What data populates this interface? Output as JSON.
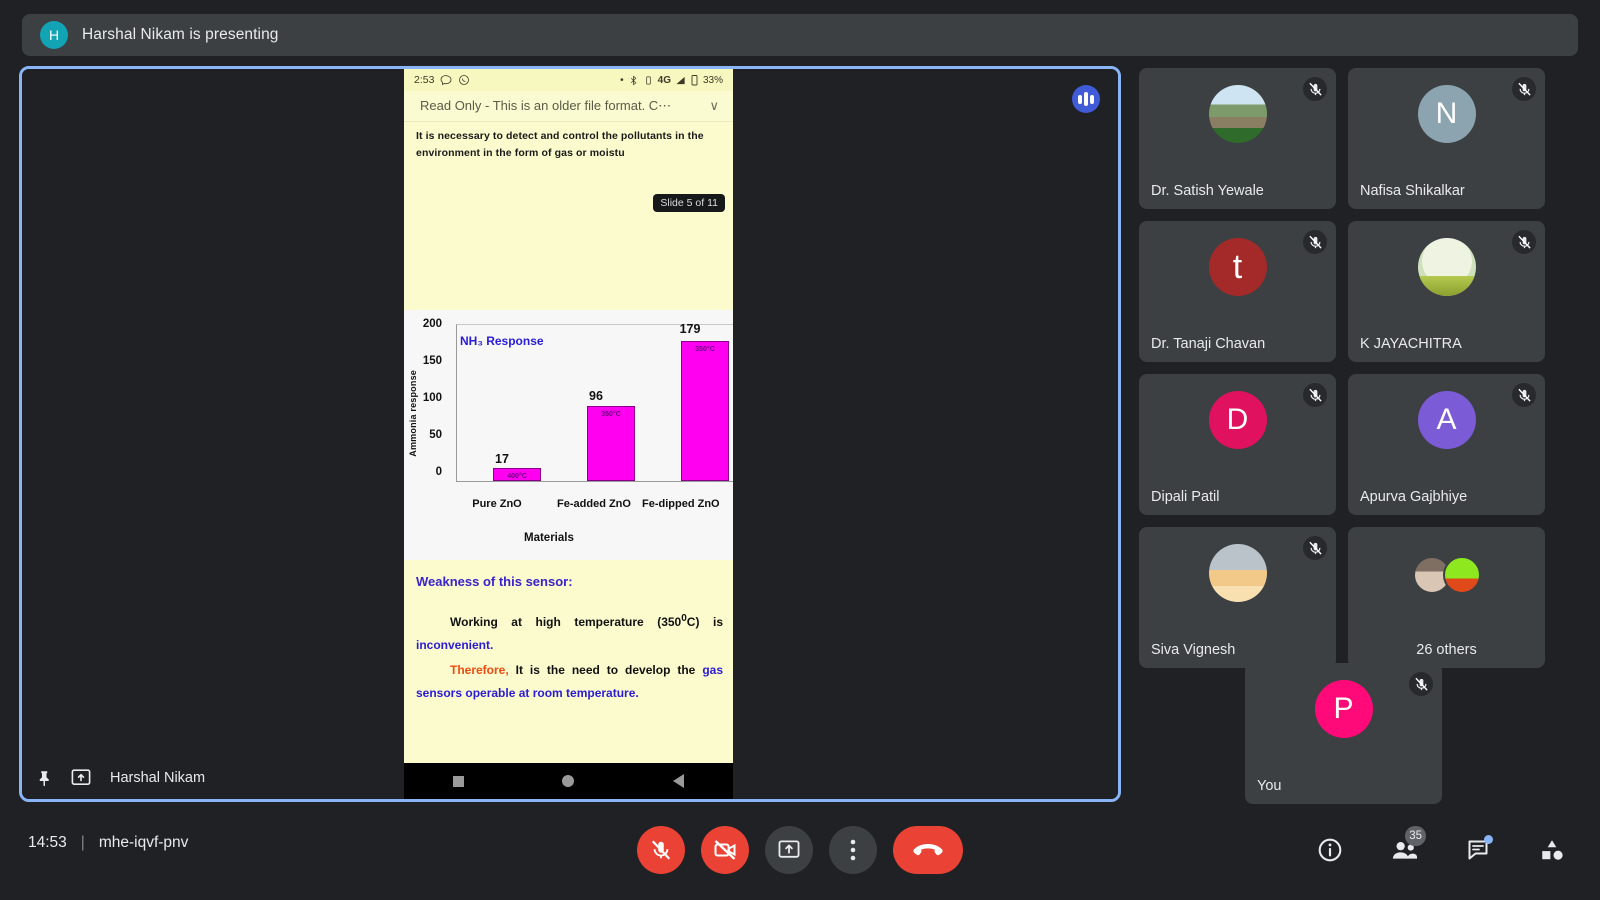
{
  "banner": {
    "avatar_initial": "H",
    "avatar_color": "#12a4b4",
    "text": "Harshal Nikam is presenting"
  },
  "stage": {
    "presenter_name": "Harshal Nikam",
    "pin_icon": "pin-icon",
    "present_icon": "present-screen-icon",
    "audio_badge_icon": "audio-levels-icon",
    "tooltip": "Slide 5 of 11"
  },
  "phone": {
    "status_time": "2:53",
    "status_network": "4G",
    "status_battery": "33%",
    "readonly_text": "Read Only - This is an older file format. C⋯",
    "chevron": "∨",
    "slide_text_top": "It is necessary to detect and control the pollutants in the environment in the form of gas or moistu",
    "weakness_heading": "Weakness of this sensor:",
    "weakness_line1_a": "Working at high temperature (350",
    "weakness_line1_sup": "0",
    "weakness_line1_b": "C) is ",
    "weakness_line1_blue": "inconvenient.",
    "weakness_line2_red": "Therefore,",
    "weakness_line2_black": " It is the need to develop the ",
    "weakness_line2_blue": "gas sensors operable at room temperature."
  },
  "chart_data": {
    "type": "bar",
    "title": "NH₃ Response",
    "xlabel": "Materials",
    "ylabel": "Ammonia response",
    "ylim": [
      0,
      200
    ],
    "yticks": [
      0,
      50,
      100,
      150,
      200
    ],
    "categories": [
      "Pure ZnO",
      "Fe-added ZnO",
      "Fe-dipped ZnO"
    ],
    "values": [
      17,
      96,
      179
    ],
    "point_labels": [
      "17",
      "96",
      "179"
    ],
    "bar_annotations": [
      "400°C",
      "350°C",
      "350°C"
    ],
    "bar_color": "#ff00f0",
    "title_color": "#2a1bd6",
    "grid": false,
    "legend": false
  },
  "participants": [
    {
      "name": "Dr. Satish Yewale",
      "avatar_type": "photo",
      "photo_class": "ph-mountain",
      "muted": true
    },
    {
      "name": "Nafisa Shikalkar",
      "avatar_type": "initial",
      "initial": "N",
      "color": "#8ba4b0",
      "muted": true
    },
    {
      "name": "Dr. Tanaji Chavan",
      "avatar_type": "initial",
      "initial": "t",
      "color": "#a42a2a",
      "muted": true
    },
    {
      "name": "K JAYACHITRA",
      "avatar_type": "photo",
      "photo_class": "ph-green",
      "muted": true
    },
    {
      "name": "Dipali Patil",
      "avatar_type": "initial",
      "initial": "D",
      "color": "#e0115f",
      "muted": true
    },
    {
      "name": "Apurva Gajbhiye",
      "avatar_type": "initial",
      "initial": "A",
      "color": "#7b5bd6",
      "muted": true
    },
    {
      "name": "Siva Vignesh",
      "avatar_type": "photo",
      "photo_class": "ph-plane",
      "muted": true
    }
  ],
  "others_tile": {
    "label": "26 others"
  },
  "you_tile": {
    "name": "You",
    "initial": "P",
    "color": "#ff0a78",
    "muted": true
  },
  "bottom": {
    "time": "14:53",
    "divider": "|",
    "meeting_code": "mhe-iqvf-pnv",
    "controls": [
      {
        "name": "microphone-off-button",
        "label": "Turn on microphone",
        "state": "danger"
      },
      {
        "name": "camera-off-button",
        "label": "Turn on camera",
        "state": "danger"
      },
      {
        "name": "present-now-button",
        "label": "Present now",
        "state": "normal"
      },
      {
        "name": "more-options-button",
        "label": "More options",
        "state": "normal"
      },
      {
        "name": "leave-call-button",
        "label": "Leave call",
        "state": "danger"
      }
    ],
    "right_icons": [
      {
        "name": "meeting-details-icon",
        "label": "Meeting details"
      },
      {
        "name": "people-icon",
        "label": "Show everyone",
        "badge": "35"
      },
      {
        "name": "chat-icon",
        "label": "Chat with everyone",
        "dot": true
      },
      {
        "name": "activities-icon",
        "label": "Activities"
      }
    ]
  }
}
